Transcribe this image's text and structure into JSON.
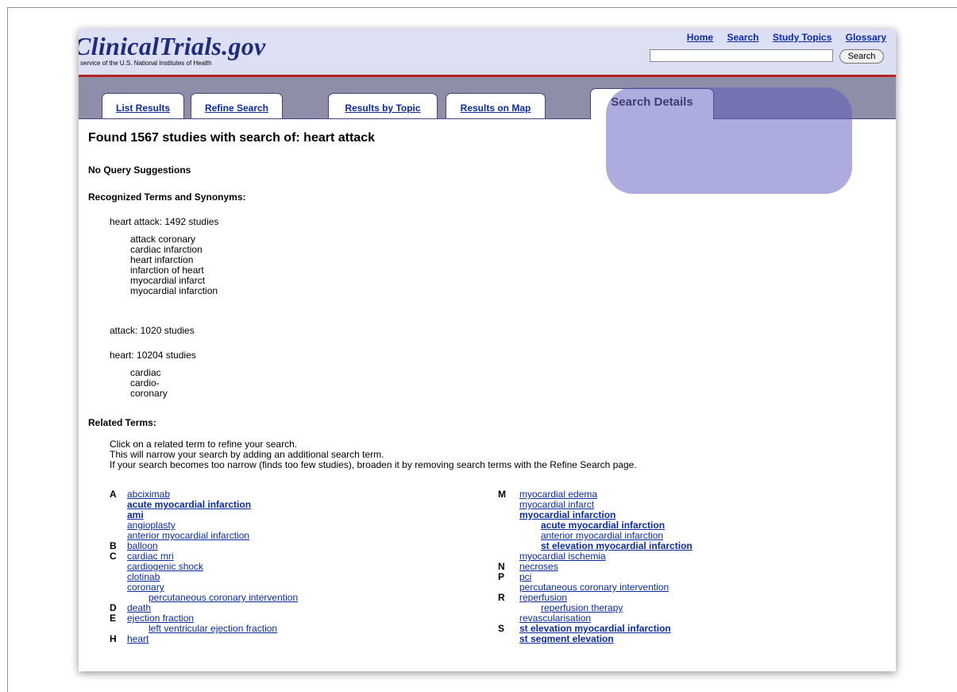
{
  "header": {
    "logo": "ClinicalTrials.gov",
    "tagline": "A service of the U.S. National Institutes of Health",
    "links": [
      "Home",
      "Search",
      "Study Topics",
      "Glossary"
    ],
    "search_value": "",
    "search_button": "Search"
  },
  "tabs": [
    "List Results",
    "Refine Search",
    "Results by Topic",
    "Results on Map",
    "Search Details"
  ],
  "main": {
    "title": "Found 1567 studies with search of:  heart attack",
    "no_suggestions": "No Query Suggestions",
    "recognized_heading": "Recognized Terms and Synonyms:",
    "terms": [
      {
        "label": "heart attack:  1492 studies",
        "synonyms": [
          "attack coronary",
          "cardiac infarction",
          "heart infarction",
          "infarction of heart",
          "myocardial infarct",
          "myocardial infarction"
        ]
      },
      {
        "label": "attack:  1020 studies",
        "synonyms": []
      },
      {
        "label": "heart:  10204 studies",
        "synonyms": [
          "cardiac",
          "cardio-",
          "coronary"
        ]
      }
    ],
    "related_heading": "Related Terms:",
    "instructions": [
      "Click on a related term to refine your search.",
      "This will narrow your search by adding an additional search term.",
      "If your search becomes too narrow (finds too few studies), broaden it by removing search terms with the Refine Search page."
    ],
    "left_terms": [
      {
        "letter": "A",
        "text": "abciximab",
        "bold": false,
        "indent": 0
      },
      {
        "letter": "",
        "text": "acute myocardial infarction",
        "bold": true,
        "indent": 0
      },
      {
        "letter": "",
        "text": "ami",
        "bold": true,
        "indent": 0
      },
      {
        "letter": "",
        "text": "angioplasty",
        "bold": false,
        "indent": 0
      },
      {
        "letter": "",
        "text": "anterior myocardial infarction",
        "bold": false,
        "indent": 0
      },
      {
        "letter": "B",
        "text": "balloon",
        "bold": false,
        "indent": 0
      },
      {
        "letter": "C",
        "text": "cardiac mri",
        "bold": false,
        "indent": 0
      },
      {
        "letter": "",
        "text": "cardiogenic shock",
        "bold": false,
        "indent": 0
      },
      {
        "letter": "",
        "text": "clotinab",
        "bold": false,
        "indent": 0
      },
      {
        "letter": "",
        "text": "coronary",
        "bold": false,
        "indent": 0
      },
      {
        "letter": "",
        "text": "percutaneous coronary intervention",
        "bold": false,
        "indent": 1
      },
      {
        "letter": "D",
        "text": "death",
        "bold": false,
        "indent": 0
      },
      {
        "letter": "E",
        "text": "ejection fraction",
        "bold": false,
        "indent": 0
      },
      {
        "letter": "",
        "text": "left ventricular ejection fraction",
        "bold": false,
        "indent": 1
      },
      {
        "letter": "H",
        "text": "heart",
        "bold": false,
        "indent": 0
      }
    ],
    "right_terms": [
      {
        "letter": "M",
        "text": "myocardial edema",
        "bold": false,
        "indent": 0
      },
      {
        "letter": "",
        "text": "myocardial infarct",
        "bold": false,
        "indent": 0
      },
      {
        "letter": "",
        "text": "myocardial infarction",
        "bold": true,
        "indent": 0
      },
      {
        "letter": "",
        "text": "acute myocardial infarction",
        "bold": true,
        "indent": 1
      },
      {
        "letter": "",
        "text": "anterior myocardial infarction",
        "bold": false,
        "indent": 1
      },
      {
        "letter": "",
        "text": "st elevation myocardial infarction",
        "bold": true,
        "indent": 1
      },
      {
        "letter": "",
        "text": "myocardial ischemia",
        "bold": false,
        "indent": 0
      },
      {
        "letter": "N",
        "text": "necroses",
        "bold": false,
        "indent": 0
      },
      {
        "letter": "P",
        "text": "pci",
        "bold": false,
        "indent": 0
      },
      {
        "letter": "",
        "text": "percutaneous coronary intervention",
        "bold": false,
        "indent": 0
      },
      {
        "letter": "R",
        "text": "reperfusion",
        "bold": false,
        "indent": 0
      },
      {
        "letter": "",
        "text": "reperfusion therapy",
        "bold": false,
        "indent": 1
      },
      {
        "letter": "",
        "text": "revascularisation",
        "bold": false,
        "indent": 0
      },
      {
        "letter": "S",
        "text": "st elevation myocardial infarction",
        "bold": true,
        "indent": 0
      },
      {
        "letter": "",
        "text": "st segment elevation",
        "bold": true,
        "indent": 0
      }
    ]
  }
}
